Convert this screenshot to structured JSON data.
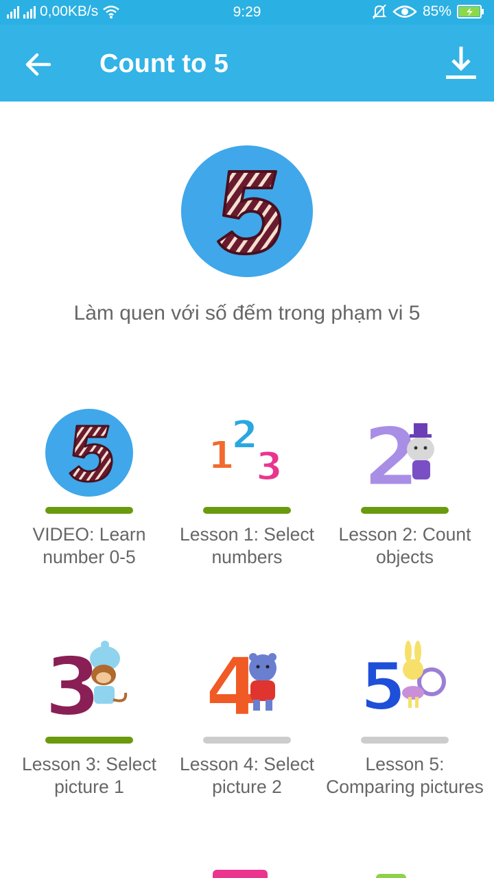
{
  "status_bar": {
    "data_rate": "0,00KB/s",
    "time": "9:29",
    "battery": "85%"
  },
  "app_bar": {
    "title": "Count to 5",
    "back_icon": "arrow-left-icon",
    "download_icon": "download-icon"
  },
  "header": {
    "subtitle": "Làm quen với số đếm trong phạm vi 5"
  },
  "lessons": [
    {
      "label": "VIDEO: Learn number 0-5",
      "completed": true
    },
    {
      "label": "Lesson 1: Select numbers",
      "completed": true
    },
    {
      "label": "Lesson 2: Count objects",
      "completed": true
    },
    {
      "label": "Lesson 3: Select picture 1",
      "completed": true
    },
    {
      "label": "Lesson 4: Select picture 2",
      "completed": false
    },
    {
      "label": "Lesson 5: Comparing pictures",
      "completed": false
    }
  ],
  "colors": {
    "primary": "#33b3e6",
    "status_bar": "#2bb0e3",
    "progress_done": "#6a9a0e",
    "progress_todo": "#cccccc"
  }
}
